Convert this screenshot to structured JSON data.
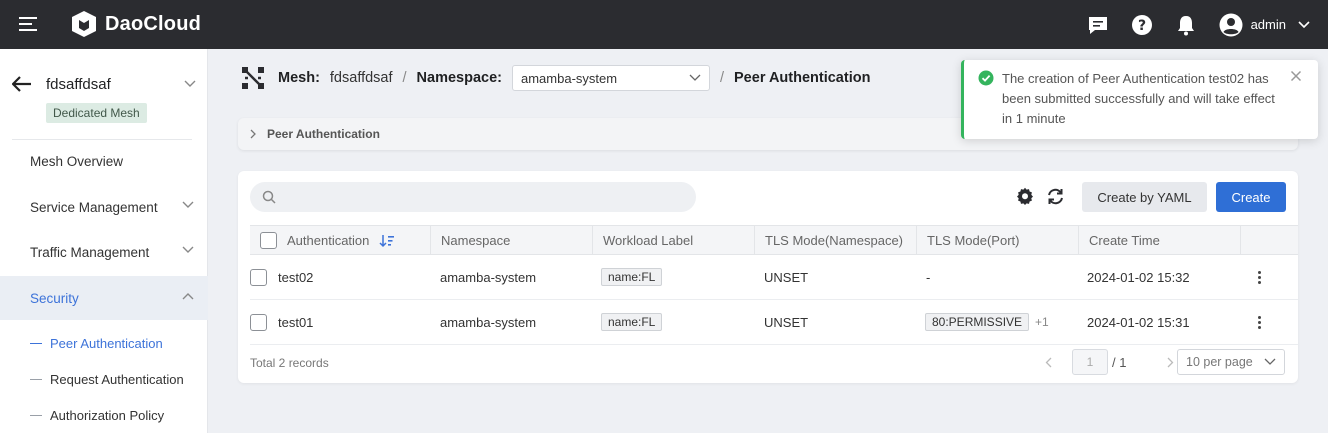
{
  "app": {
    "brand": "DaoCloud",
    "user": "admin"
  },
  "sidebar": {
    "mesh_name": "fdsaffdsaf",
    "mesh_badge": "Dedicated Mesh",
    "items": [
      {
        "label": "Mesh Overview"
      },
      {
        "label": "Service Management"
      },
      {
        "label": "Traffic Management"
      },
      {
        "label": "Security"
      }
    ],
    "subitems": [
      {
        "label": "Peer Authentication"
      },
      {
        "label": "Request Authentication"
      },
      {
        "label": "Authorization Policy"
      }
    ]
  },
  "header": {
    "mesh_label": "Mesh:",
    "mesh_value": "fdsaffdsaf",
    "separator": "/",
    "ns_label": "Namespace:",
    "ns_value": "amamba-system",
    "page_title": "Peer Authentication"
  },
  "collapse": {
    "label": "Peer Authentication"
  },
  "toolbar": {
    "search_placeholder": "",
    "yaml_label": "Create by YAML",
    "create_label": "Create"
  },
  "table": {
    "columns": [
      "Authentication",
      "Namespace",
      "Workload Label",
      "TLS Mode(Namespace)",
      "TLS Mode(Port)",
      "Create Time"
    ],
    "rows": [
      {
        "name": "test02",
        "namespace": "amamba-system",
        "label": "name:FL",
        "tls_ns": "UNSET",
        "tls_port": "-",
        "tls_port_more": "",
        "time": "2024-01-02 15:32"
      },
      {
        "name": "test01",
        "namespace": "amamba-system",
        "label": "name:FL",
        "tls_ns": "UNSET",
        "tls_port": "80:PERMISSIVE",
        "tls_port_more": "+1",
        "time": "2024-01-02 15:31"
      }
    ]
  },
  "pagination": {
    "total_text": "Total 2 records",
    "page": "1",
    "page_total": "/ 1",
    "per_page": "10 per page"
  },
  "toast": {
    "message": "The creation of Peer Authentication test02 has been submitted successfully and will take effect in 1 minute"
  },
  "colors": {
    "primary": "#2f6fd6",
    "active_nav": "#3d73d9",
    "success": "#34b45d",
    "topbar": "#2b2c30"
  }
}
